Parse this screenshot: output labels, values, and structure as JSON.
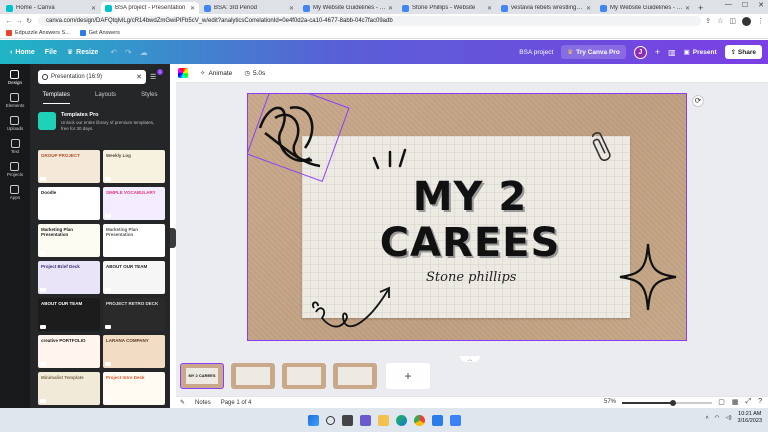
{
  "browser": {
    "tabs": [
      {
        "title": "Home - Canva",
        "color": "#00c4cc",
        "active": false
      },
      {
        "title": "BSA project - Presentation",
        "color": "#00c4cc",
        "active": true
      },
      {
        "title": "BSA: 3rd Period",
        "color": "#4285f4",
        "active": false
      },
      {
        "title": "My Website Guidelines - Daily",
        "color": "#4285f4",
        "active": false
      },
      {
        "title": "Stone Phillips - Website",
        "color": "#4285f4",
        "active": false
      },
      {
        "title": "vestavia rebels wrestling team",
        "color": "#4285f4",
        "active": false
      },
      {
        "title": "My Website Guidelines - Daily",
        "color": "#4285f4",
        "active": false
      }
    ],
    "url": "canva.com/design/DAFQtqlvlLg/cR14bwdZmGwiPIFb5cV_w/edit?analyticsCorrelationId=0e4f0d2a-ca10-4677-8abb-04c7fac09adb",
    "bookmarks": [
      {
        "label": "Edpuzzle Answers S...",
        "color": "#e8452c"
      },
      {
        "label": "Get Answers",
        "color": "#2a7de1"
      }
    ]
  },
  "canva": {
    "home": "Home",
    "file": "File",
    "resize": "Resize",
    "project_name": "BSA project",
    "try_pro": "Try Canva Pro",
    "avatar_letter": "J",
    "present": "Present",
    "share": "Share"
  },
  "rail": [
    {
      "label": "Design",
      "active": true
    },
    {
      "label": "Elements",
      "active": false
    },
    {
      "label": "Uploads",
      "active": false
    },
    {
      "label": "Text",
      "active": false
    },
    {
      "label": "Projects",
      "active": false
    },
    {
      "label": "Apps",
      "active": false
    }
  ],
  "panel": {
    "search_value": "Presentation (16:9)",
    "filter_count": "1",
    "tabs": [
      "Templates",
      "Layouts",
      "Styles"
    ],
    "promo_title": "Templates Pro",
    "promo_desc": "Unlock our entire library of premium templates, free for 30 days.",
    "templates": [
      {
        "label": "GROUP PROJECT",
        "bg": "#f4e9d8",
        "fg": "#b0502a"
      },
      {
        "label": "Weekly Log",
        "bg": "#f7f1df",
        "fg": "#5a4a3a"
      },
      {
        "label": "Doodle",
        "bg": "#ffffff",
        "fg": "#222222"
      },
      {
        "label": "SIMPLE VOCABULARY",
        "bg": "#f3ecff",
        "fg": "#e5387a"
      },
      {
        "label": "Marketing Plan Presentation",
        "bg": "#fbfbf2",
        "fg": "#222222"
      },
      {
        "label": "Marketing Plan Presentation",
        "bg": "#ffffff",
        "fg": "#555555"
      },
      {
        "label": "Project Brief Deck",
        "bg": "#e9e4f7",
        "fg": "#3a2d7a"
      },
      {
        "label": "ABOUT OUR TEAM",
        "bg": "#f6f6f6",
        "fg": "#222222"
      },
      {
        "label": "ABOUT OUR TEAM",
        "bg": "#1c1c1c",
        "fg": "#ffffff"
      },
      {
        "label": "PROJECT RETRO DECK",
        "bg": "#2a2a2a",
        "fg": "#e0e0e0"
      },
      {
        "label": "creative PORTFOLIO",
        "bg": "#fff4ee",
        "fg": "#222222"
      },
      {
        "label": "LARANA COMPANY",
        "bg": "#f3dcc4",
        "fg": "#5a3a1e"
      },
      {
        "label": "Minimalist Template",
        "bg": "#f1ead9",
        "fg": "#7a6a4a"
      },
      {
        "label": "Project Intro Deck",
        "bg": "#fffaf2",
        "fg": "#d55a2a"
      }
    ]
  },
  "toolbar": {
    "animate": "Animate",
    "duration": "5.0s"
  },
  "slide": {
    "title": "MY 2 CAREES",
    "subtitle": "Stone phillips"
  },
  "pages": [
    {
      "label": "MY 2 CAREES",
      "active": true
    },
    {
      "label": "",
      "active": false
    },
    {
      "label": "",
      "active": false
    },
    {
      "label": "",
      "active": false
    }
  ],
  "footer": {
    "notes": "Notes",
    "page_indicator": "Page 1 of 4",
    "zoom": "57%",
    "zoom_level": 0.57
  },
  "taskbar": {
    "time": "10:21 AM",
    "date": "3/16/2023"
  }
}
